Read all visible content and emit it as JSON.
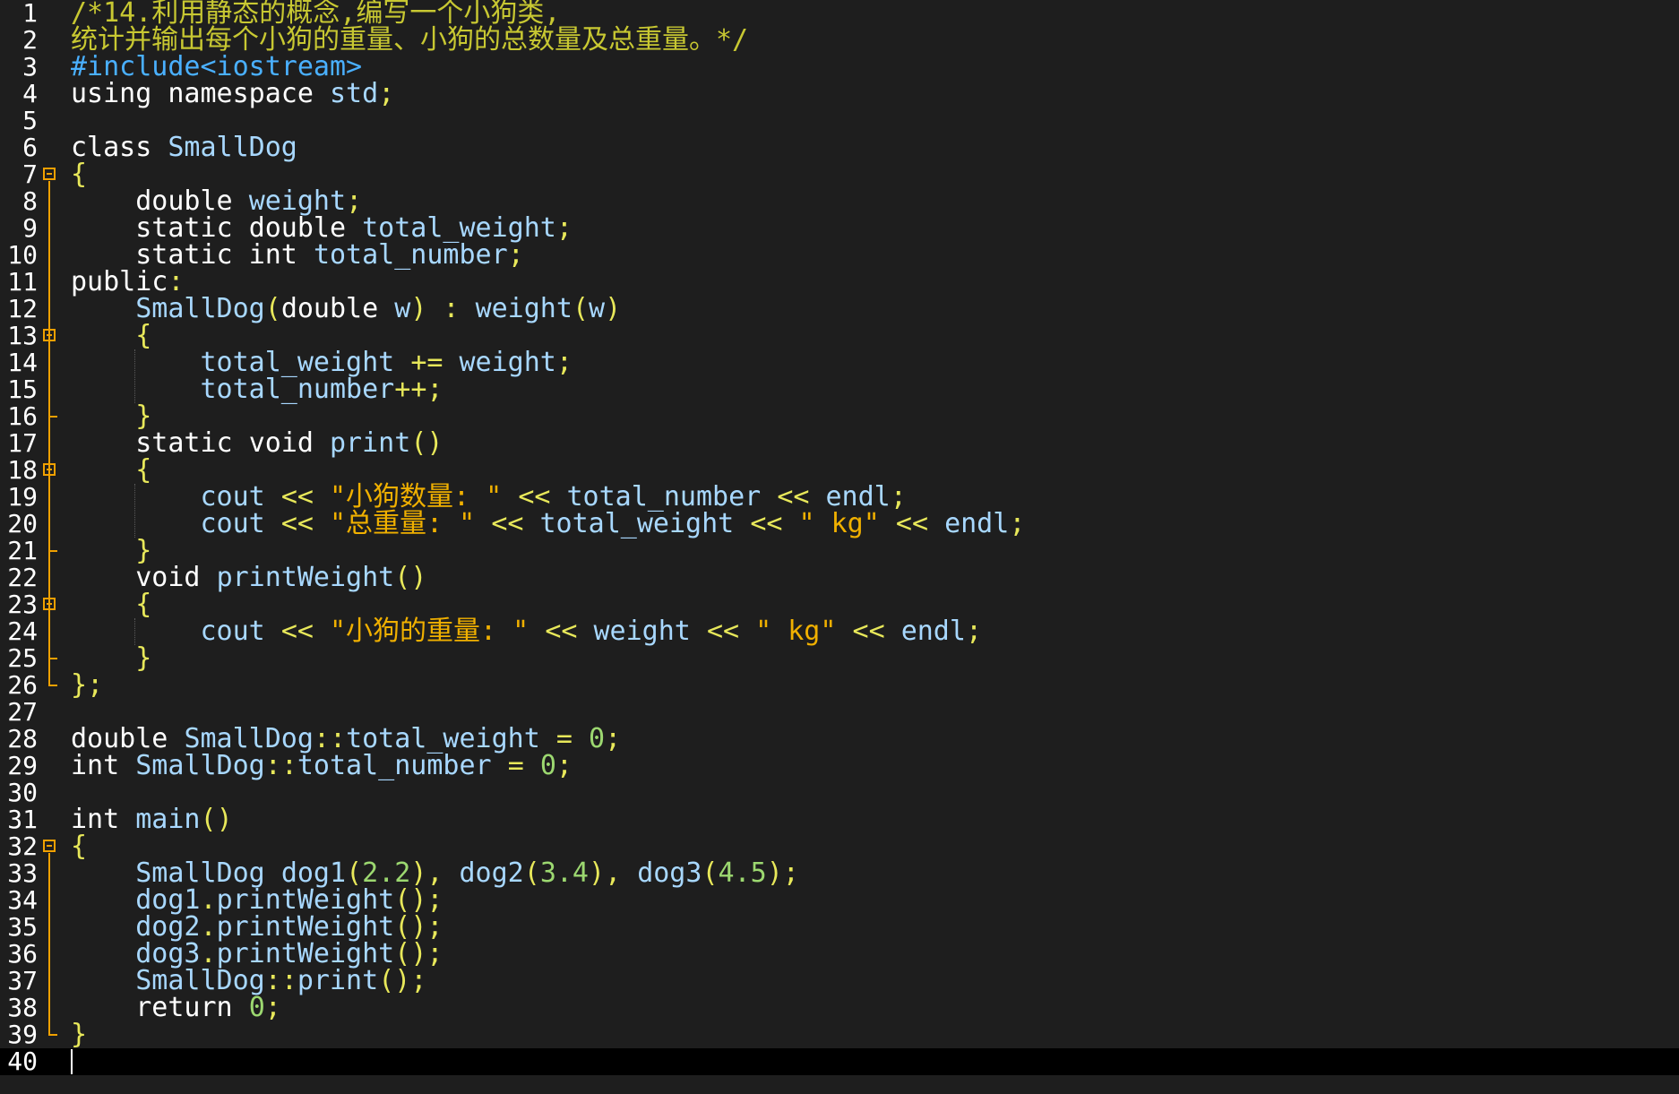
{
  "editor": {
    "language": "C++",
    "cursor_line": 40,
    "lines": [
      "/*14.利用静态的概念,编写一个小狗类,",
      "统计并输出每个小狗的重量、小狗的总数量及总重量。*/",
      "#include<iostream>",
      "using namespace std;",
      "",
      "class SmallDog",
      "{",
      "    double weight;",
      "    static double total_weight;",
      "    static int total_number;",
      "public:",
      "    SmallDog(double w) : weight(w)",
      "    {",
      "        total_weight += weight;",
      "        total_number++;",
      "    }",
      "    static void print()",
      "    {",
      "        cout << \"小狗数量: \" << total_number << endl;",
      "        cout << \"总重量: \" << total_weight << \" kg\" << endl;",
      "    }",
      "    void printWeight()",
      "    {",
      "        cout << \"小狗的重量: \" << weight << \" kg\" << endl;",
      "    }",
      "};",
      "",
      "double SmallDog::total_weight = 0;",
      "int SmallDog::total_number = 0;",
      "",
      "int main()",
      "{",
      "    SmallDog dog1(2.2), dog2(3.4), dog3(4.5);",
      "    dog1.printWeight();",
      "    dog2.printWeight();",
      "    dog3.printWeight();",
      "    SmallDog::print();",
      "    return 0;",
      "}",
      ""
    ],
    "fold_markers": [
      7,
      13,
      18,
      23,
      32
    ],
    "colors": {
      "background": "#1e1e1e",
      "comment": "#c8c832",
      "preprocessor": "#4ab0ff",
      "identifier": "#a8d8ff",
      "punctuation": "#e8e85a",
      "string": "#f0b000",
      "number": "#9cd870",
      "fold": "#f0a000",
      "current_line": "#000000"
    }
  }
}
